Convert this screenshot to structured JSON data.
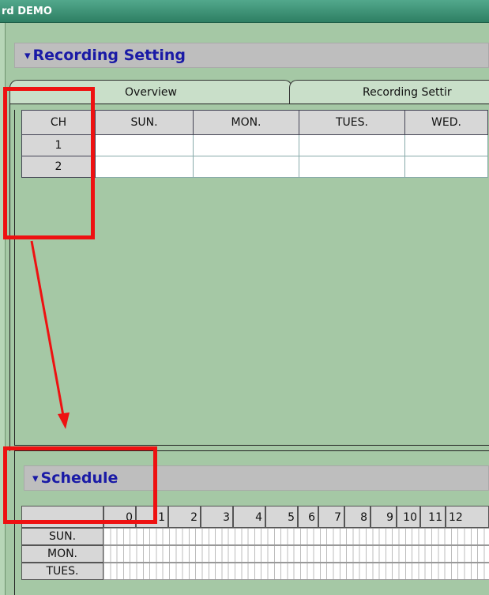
{
  "window": {
    "title": "rd DEMO"
  },
  "recording_section": {
    "title": "Recording Setting",
    "icon": "chevron-down-icon"
  },
  "tabs": [
    {
      "label": "Overview",
      "selected": true
    },
    {
      "label": "Recording Settir",
      "selected": false
    }
  ],
  "channel_table": {
    "headers": [
      "CH",
      "SUN.",
      "MON.",
      "TUES.",
      "WED."
    ],
    "rows": [
      {
        "ch": "1"
      },
      {
        "ch": "2"
      }
    ]
  },
  "schedule_section": {
    "title": "Schedule",
    "icon": "chevron-down-icon"
  },
  "schedule": {
    "hours": [
      "0",
      "1",
      "2",
      "3",
      "4",
      "5",
      "6",
      "7",
      "8",
      "9",
      "10",
      "11",
      "12"
    ],
    "days": [
      "SUN.",
      "MON.",
      "TUES."
    ]
  },
  "annotation": {
    "color": "#ee1111"
  }
}
